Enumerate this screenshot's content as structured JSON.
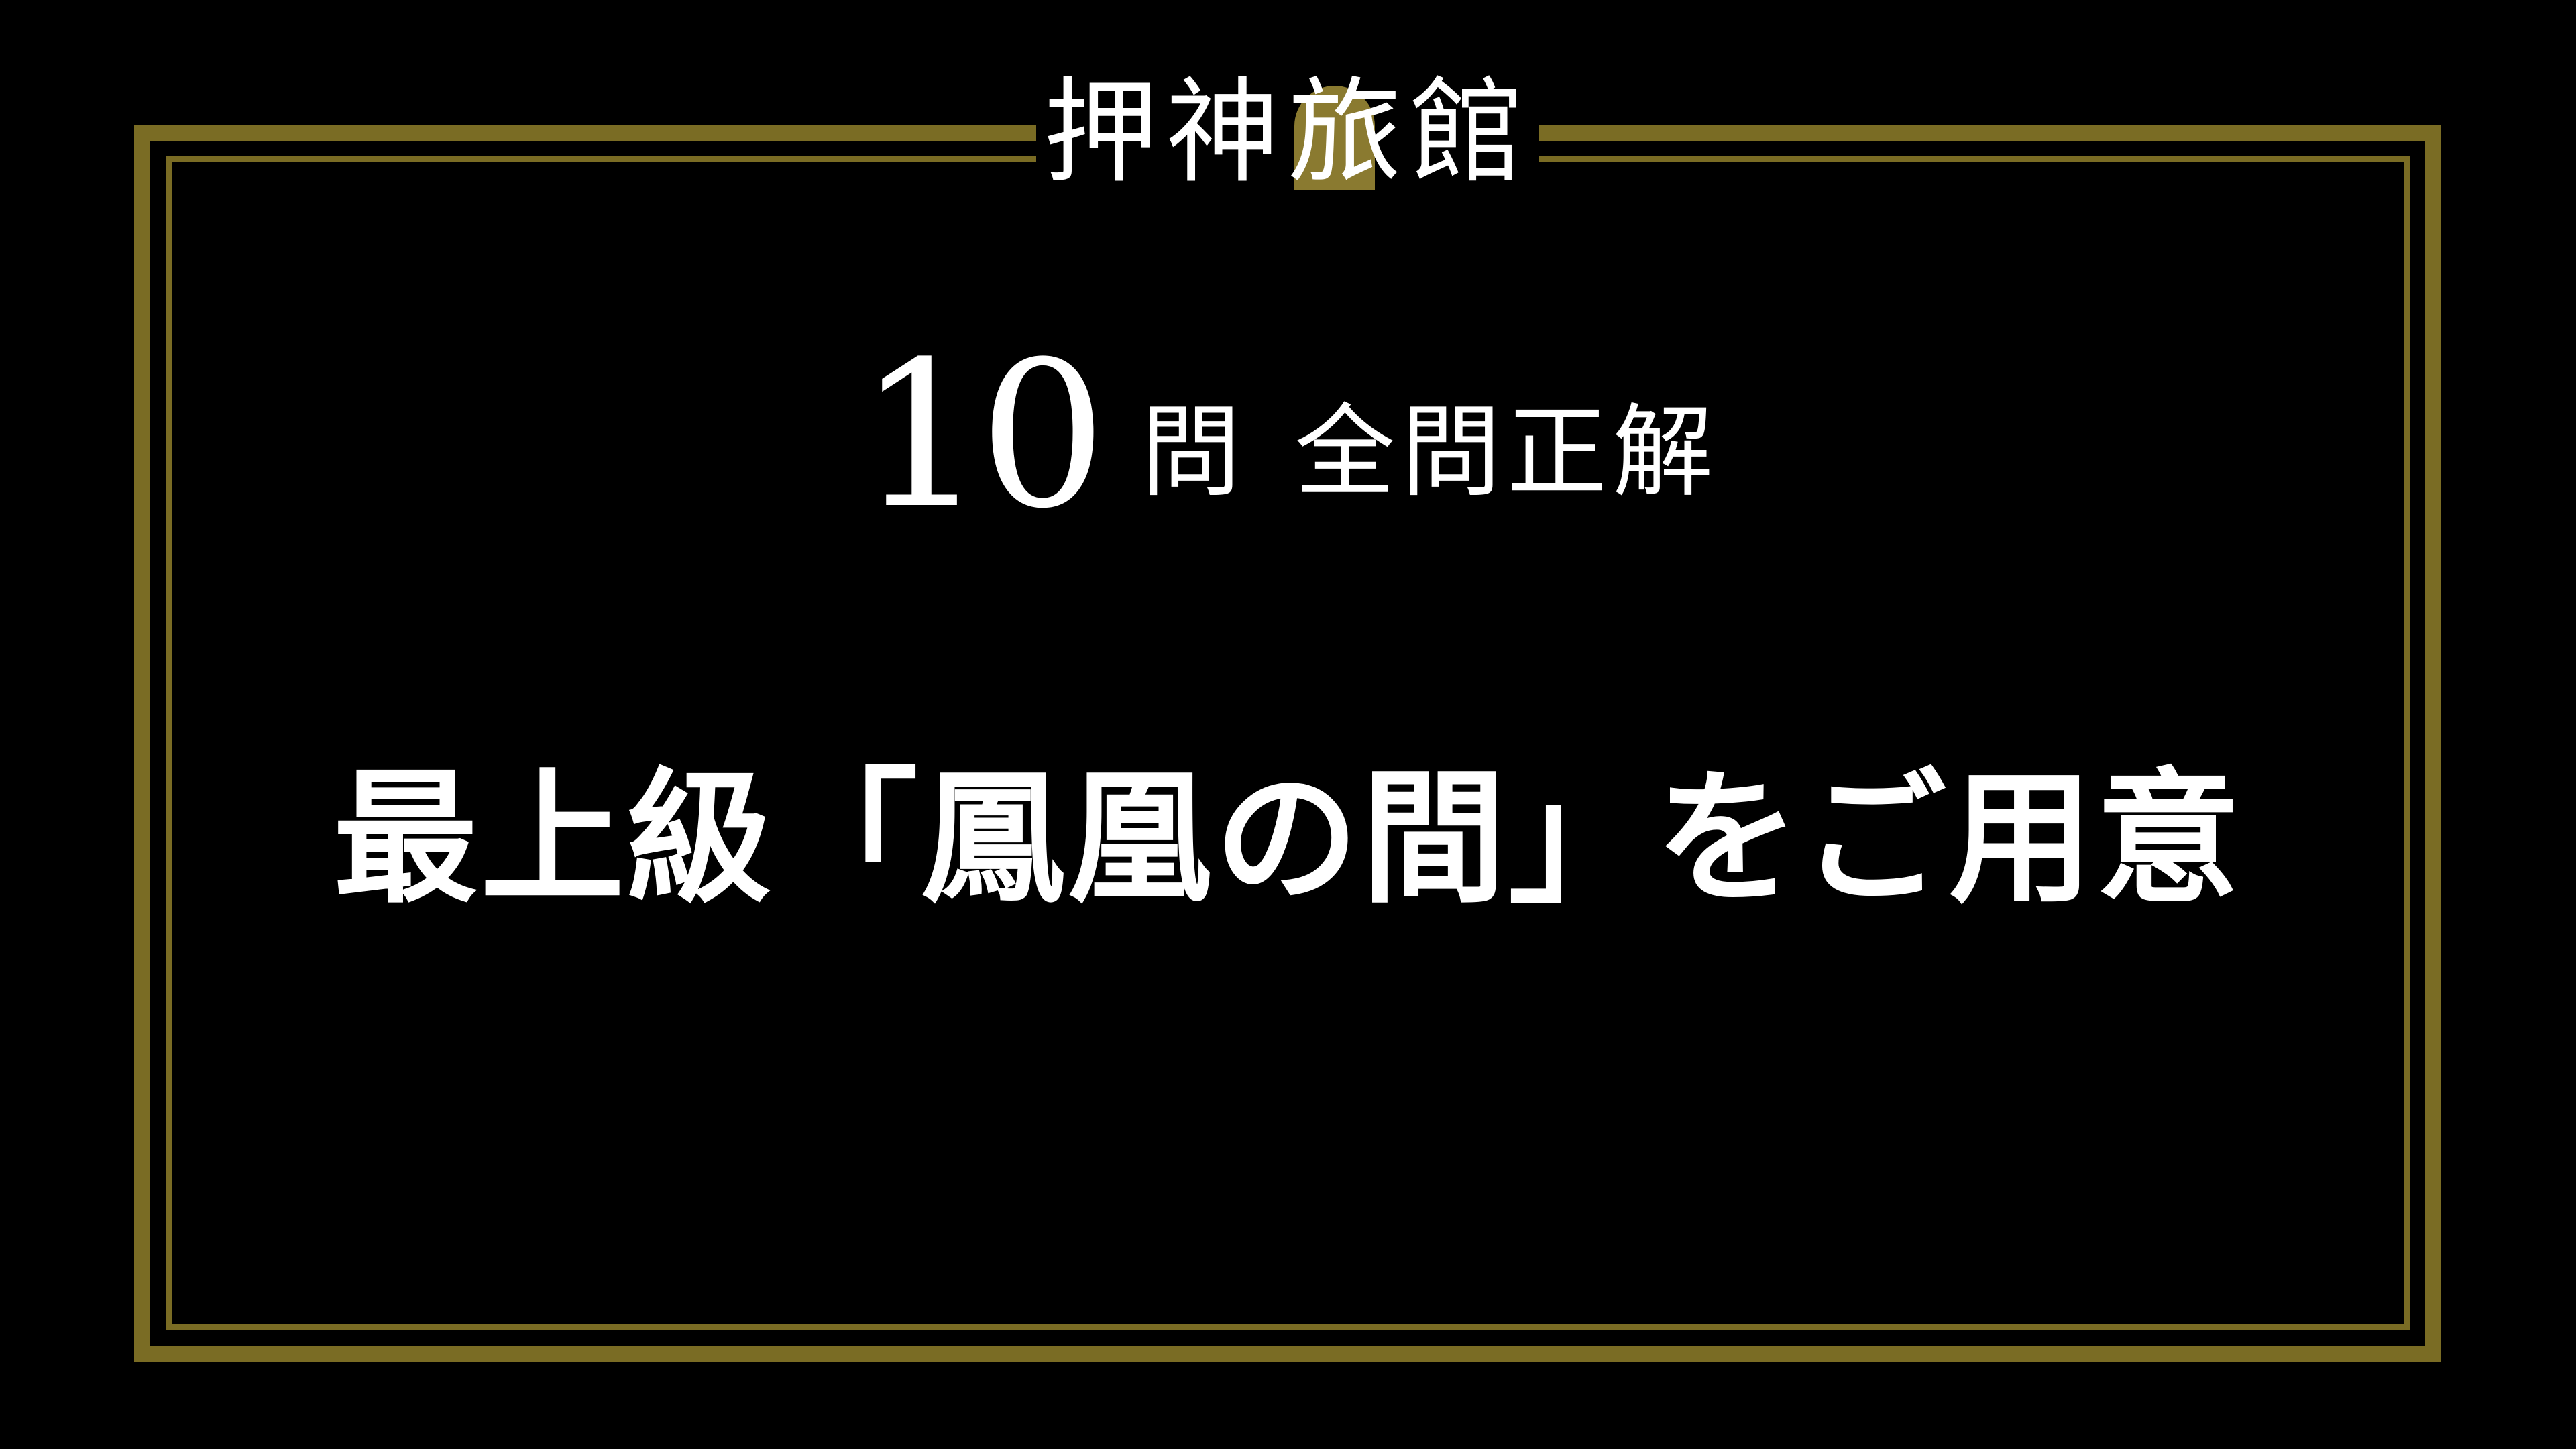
{
  "logo": {
    "text": "押神旅館"
  },
  "score": {
    "number": "10",
    "unit": "問",
    "label": "全問正解"
  },
  "headline": {
    "text": "最上級「鳳凰の間」をご用意"
  },
  "colors": {
    "background": "#000000",
    "frame": "#7a6c24",
    "text": "#ffffff",
    "logo_accent": "#8a7a30"
  }
}
